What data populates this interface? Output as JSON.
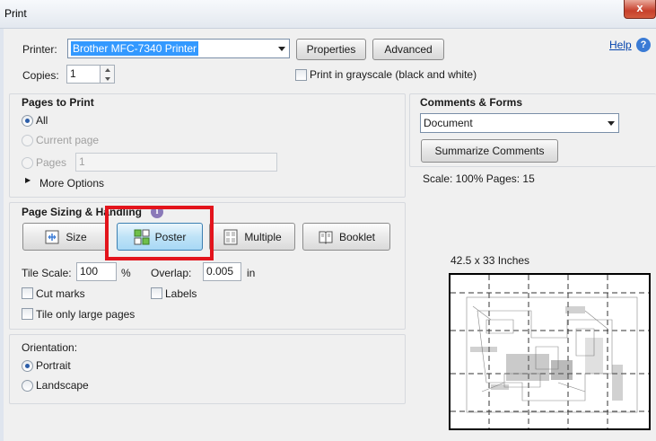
{
  "window": {
    "title": "Print",
    "close_glyph": "x"
  },
  "printer": {
    "label": "Printer:",
    "selected": "Brother MFC-7340 Printer",
    "properties_label": "Properties",
    "advanced_label": "Advanced",
    "help_label": "Help",
    "help_glyph": "?"
  },
  "copies": {
    "label": "Copies:",
    "value": "1"
  },
  "grayscale": {
    "label": "Print in grayscale (black and white)",
    "checked": false
  },
  "pages_to_print": {
    "title": "Pages to Print",
    "all_label": "All",
    "current_label": "Current page",
    "pages_label": "Pages",
    "pages_value": "1",
    "more_options_label": "More Options",
    "selected": "All"
  },
  "page_sizing": {
    "title": "Page Sizing & Handling",
    "info_glyph": "i",
    "buttons": [
      "Size",
      "Poster",
      "Multiple",
      "Booklet"
    ],
    "active": "Poster",
    "tile_scale_label": "Tile Scale:",
    "tile_scale_value": "100",
    "tile_scale_unit": "%",
    "overlap_label": "Overlap:",
    "overlap_value": "0.005",
    "overlap_unit": "in",
    "cut_marks_label": "Cut marks",
    "labels_label": "Labels",
    "tile_large_label": "Tile only large pages"
  },
  "orientation": {
    "title": "Orientation:",
    "portrait_label": "Portrait",
    "landscape_label": "Landscape",
    "selected": "Portrait"
  },
  "comments_forms": {
    "title": "Comments & Forms",
    "selected": "Document",
    "summarize_label": "Summarize Comments"
  },
  "preview": {
    "scale_text": "Scale: 100% Pages: 15",
    "size_text": "42.5 x 33 Inches"
  },
  "colors": {
    "highlight_box": "#e3141c",
    "selection_blue": "#3399ff",
    "active_button": "#bfe3f7",
    "link": "#0645ad"
  }
}
